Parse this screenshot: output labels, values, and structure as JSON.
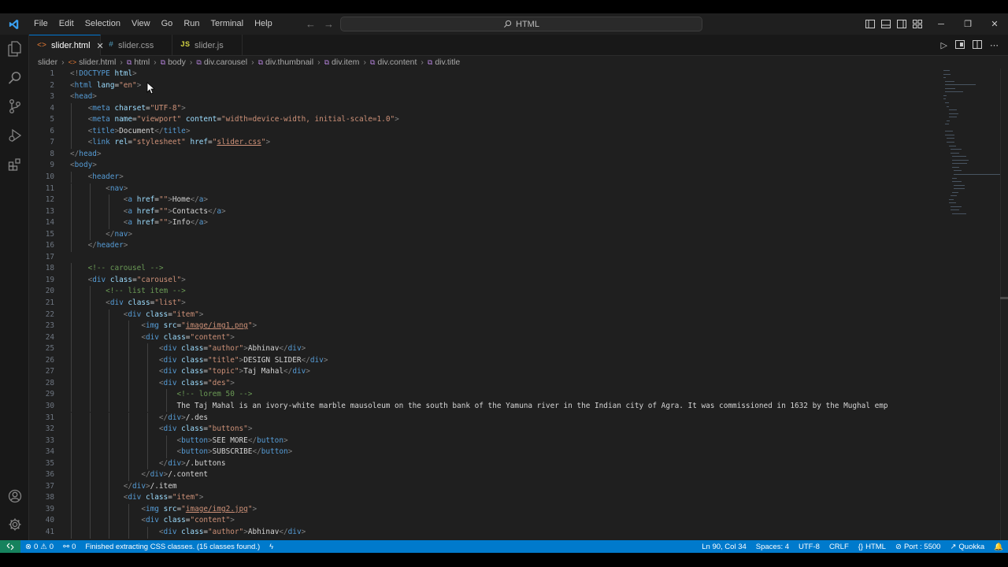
{
  "window": {
    "menu": [
      "File",
      "Edit",
      "Selection",
      "View",
      "Go",
      "Run",
      "Terminal",
      "Help"
    ],
    "search_text": "HTML"
  },
  "tabs": [
    {
      "label": "slider.html",
      "icon": "<>",
      "active": true
    },
    {
      "label": "slider.css",
      "icon": "#",
      "active": false
    },
    {
      "label": "slider.js",
      "icon": "JS",
      "active": false
    }
  ],
  "breadcrumb": [
    "slider",
    "slider.html",
    "html",
    "body",
    "div.carousel",
    "div.thumbnail",
    "div.item",
    "div.content",
    "div.title"
  ],
  "line_numbers": [
    "1",
    "2",
    "3",
    "4",
    "5",
    "6",
    "7",
    "8",
    "9",
    "10",
    "11",
    "12",
    "13",
    "14",
    "15",
    "16",
    "17",
    "18",
    "19",
    "20",
    "21",
    "22",
    "23",
    "24",
    "25",
    "26",
    "27",
    "28",
    "29",
    "30",
    "31",
    "32",
    "33",
    "34",
    "35",
    "36",
    "37",
    "38",
    "39",
    "40",
    "41"
  ],
  "code_lines": [
    [
      [
        "br",
        "<!"
      ],
      [
        "tag",
        "DOCTYPE"
      ],
      [
        "txt",
        " "
      ],
      [
        "attr",
        "html"
      ],
      [
        "br",
        ">"
      ]
    ],
    [
      [
        "br",
        "<"
      ],
      [
        "tag",
        "html"
      ],
      [
        "txt",
        " "
      ],
      [
        "attr",
        "lang"
      ],
      [
        "txt",
        "="
      ],
      [
        "str",
        "\"en\""
      ],
      [
        "br",
        ">"
      ]
    ],
    [
      [
        "br",
        "<"
      ],
      [
        "tag",
        "head"
      ],
      [
        "br",
        ">"
      ]
    ],
    [
      [
        "txt",
        "    "
      ],
      [
        "br",
        "<"
      ],
      [
        "tag",
        "meta"
      ],
      [
        "txt",
        " "
      ],
      [
        "attr",
        "charset"
      ],
      [
        "txt",
        "="
      ],
      [
        "str",
        "\"UTF-8\""
      ],
      [
        "br",
        ">"
      ]
    ],
    [
      [
        "txt",
        "    "
      ],
      [
        "br",
        "<"
      ],
      [
        "tag",
        "meta"
      ],
      [
        "txt",
        " "
      ],
      [
        "attr",
        "name"
      ],
      [
        "txt",
        "="
      ],
      [
        "str",
        "\"viewport\""
      ],
      [
        "txt",
        " "
      ],
      [
        "attr",
        "content"
      ],
      [
        "txt",
        "="
      ],
      [
        "str",
        "\"width=device-width, initial-scale=1.0\""
      ],
      [
        "br",
        ">"
      ]
    ],
    [
      [
        "txt",
        "    "
      ],
      [
        "br",
        "<"
      ],
      [
        "tag",
        "title"
      ],
      [
        "br",
        ">"
      ],
      [
        "txt",
        "Document"
      ],
      [
        "br",
        "</"
      ],
      [
        "tag",
        "title"
      ],
      [
        "br",
        ">"
      ]
    ],
    [
      [
        "txt",
        "    "
      ],
      [
        "br",
        "<"
      ],
      [
        "tag",
        "link"
      ],
      [
        "txt",
        " "
      ],
      [
        "attr",
        "rel"
      ],
      [
        "txt",
        "="
      ],
      [
        "str",
        "\"stylesheet\""
      ],
      [
        "txt",
        " "
      ],
      [
        "attr",
        "href"
      ],
      [
        "txt",
        "="
      ],
      [
        "str",
        "\""
      ],
      [
        "link",
        "slider.css"
      ],
      [
        "str",
        "\""
      ],
      [
        "br",
        ">"
      ]
    ],
    [
      [
        "br",
        "</"
      ],
      [
        "tag",
        "head"
      ],
      [
        "br",
        ">"
      ]
    ],
    [
      [
        "br",
        "<"
      ],
      [
        "tag",
        "body"
      ],
      [
        "br",
        ">"
      ]
    ],
    [
      [
        "txt",
        "    "
      ],
      [
        "br",
        "<"
      ],
      [
        "tag",
        "header"
      ],
      [
        "br",
        ">"
      ]
    ],
    [
      [
        "txt",
        "        "
      ],
      [
        "br",
        "<"
      ],
      [
        "tag",
        "nav"
      ],
      [
        "br",
        ">"
      ]
    ],
    [
      [
        "txt",
        "            "
      ],
      [
        "br",
        "<"
      ],
      [
        "tag",
        "a"
      ],
      [
        "txt",
        " "
      ],
      [
        "attr",
        "href"
      ],
      [
        "txt",
        "="
      ],
      [
        "str",
        "\"\""
      ],
      [
        "br",
        ">"
      ],
      [
        "txt",
        "Home"
      ],
      [
        "br",
        "</"
      ],
      [
        "tag",
        "a"
      ],
      [
        "br",
        ">"
      ]
    ],
    [
      [
        "txt",
        "            "
      ],
      [
        "br",
        "<"
      ],
      [
        "tag",
        "a"
      ],
      [
        "txt",
        " "
      ],
      [
        "attr",
        "href"
      ],
      [
        "txt",
        "="
      ],
      [
        "str",
        "\"\""
      ],
      [
        "br",
        ">"
      ],
      [
        "txt",
        "Contacts"
      ],
      [
        "br",
        "</"
      ],
      [
        "tag",
        "a"
      ],
      [
        "br",
        ">"
      ]
    ],
    [
      [
        "txt",
        "            "
      ],
      [
        "br",
        "<"
      ],
      [
        "tag",
        "a"
      ],
      [
        "txt",
        " "
      ],
      [
        "attr",
        "href"
      ],
      [
        "txt",
        "="
      ],
      [
        "str",
        "\"\""
      ],
      [
        "br",
        ">"
      ],
      [
        "txt",
        "Info"
      ],
      [
        "br",
        "</"
      ],
      [
        "tag",
        "a"
      ],
      [
        "br",
        ">"
      ]
    ],
    [
      [
        "txt",
        "        "
      ],
      [
        "br",
        "</"
      ],
      [
        "tag",
        "nav"
      ],
      [
        "br",
        ">"
      ]
    ],
    [
      [
        "txt",
        "    "
      ],
      [
        "br",
        "</"
      ],
      [
        "tag",
        "header"
      ],
      [
        "br",
        ">"
      ]
    ],
    [],
    [
      [
        "txt",
        "    "
      ],
      [
        "cm",
        "<!-- carousel -->"
      ]
    ],
    [
      [
        "txt",
        "    "
      ],
      [
        "br",
        "<"
      ],
      [
        "tag",
        "div"
      ],
      [
        "txt",
        " "
      ],
      [
        "attr",
        "class"
      ],
      [
        "txt",
        "="
      ],
      [
        "str",
        "\"carousel\""
      ],
      [
        "br",
        ">"
      ]
    ],
    [
      [
        "txt",
        "        "
      ],
      [
        "cm",
        "<!-- list item -->"
      ]
    ],
    [
      [
        "txt",
        "        "
      ],
      [
        "br",
        "<"
      ],
      [
        "tag",
        "div"
      ],
      [
        "txt",
        " "
      ],
      [
        "attr",
        "class"
      ],
      [
        "txt",
        "="
      ],
      [
        "str",
        "\"list\""
      ],
      [
        "br",
        ">"
      ]
    ],
    [
      [
        "txt",
        "            "
      ],
      [
        "br",
        "<"
      ],
      [
        "tag",
        "div"
      ],
      [
        "txt",
        " "
      ],
      [
        "attr",
        "class"
      ],
      [
        "txt",
        "="
      ],
      [
        "str",
        "\"item\""
      ],
      [
        "br",
        ">"
      ]
    ],
    [
      [
        "txt",
        "                "
      ],
      [
        "br",
        "<"
      ],
      [
        "tag",
        "img"
      ],
      [
        "txt",
        " "
      ],
      [
        "attr",
        "src"
      ],
      [
        "txt",
        "="
      ],
      [
        "str",
        "\""
      ],
      [
        "link",
        "image/img1.png"
      ],
      [
        "str",
        "\""
      ],
      [
        "br",
        ">"
      ]
    ],
    [
      [
        "txt",
        "                "
      ],
      [
        "br",
        "<"
      ],
      [
        "tag",
        "div"
      ],
      [
        "txt",
        " "
      ],
      [
        "attr",
        "class"
      ],
      [
        "txt",
        "="
      ],
      [
        "str",
        "\"content\""
      ],
      [
        "br",
        ">"
      ]
    ],
    [
      [
        "txt",
        "                    "
      ],
      [
        "br",
        "<"
      ],
      [
        "tag",
        "div"
      ],
      [
        "txt",
        " "
      ],
      [
        "attr",
        "class"
      ],
      [
        "txt",
        "="
      ],
      [
        "str",
        "\"author\""
      ],
      [
        "br",
        ">"
      ],
      [
        "txt",
        "Abhinav"
      ],
      [
        "br",
        "</"
      ],
      [
        "tag",
        "div"
      ],
      [
        "br",
        ">"
      ]
    ],
    [
      [
        "txt",
        "                    "
      ],
      [
        "br",
        "<"
      ],
      [
        "tag",
        "div"
      ],
      [
        "txt",
        " "
      ],
      [
        "attr",
        "class"
      ],
      [
        "txt",
        "="
      ],
      [
        "str",
        "\"title\""
      ],
      [
        "br",
        ">"
      ],
      [
        "txt",
        "DESIGN SLIDER"
      ],
      [
        "br",
        "</"
      ],
      [
        "tag",
        "div"
      ],
      [
        "br",
        ">"
      ]
    ],
    [
      [
        "txt",
        "                    "
      ],
      [
        "br",
        "<"
      ],
      [
        "tag",
        "div"
      ],
      [
        "txt",
        " "
      ],
      [
        "attr",
        "class"
      ],
      [
        "txt",
        "="
      ],
      [
        "str",
        "\"topic\""
      ],
      [
        "br",
        ">"
      ],
      [
        "txt",
        "Taj Mahal"
      ],
      [
        "br",
        "</"
      ],
      [
        "tag",
        "div"
      ],
      [
        "br",
        ">"
      ]
    ],
    [
      [
        "txt",
        "                    "
      ],
      [
        "br",
        "<"
      ],
      [
        "tag",
        "div"
      ],
      [
        "txt",
        " "
      ],
      [
        "attr",
        "class"
      ],
      [
        "txt",
        "="
      ],
      [
        "str",
        "\"des\""
      ],
      [
        "br",
        ">"
      ]
    ],
    [
      [
        "txt",
        "                        "
      ],
      [
        "cm",
        "<!-- lorem 50 -->"
      ]
    ],
    [
      [
        "txt",
        "                        The Taj Mahal is an ivory-white marble mausoleum on the south bank of the Yamuna river in the Indian city of Agra. It was commissioned in 1632 by the Mughal emp"
      ]
    ],
    [
      [
        "txt",
        "                    "
      ],
      [
        "br",
        "</"
      ],
      [
        "tag",
        "div"
      ],
      [
        "br",
        ">"
      ],
      [
        "txt",
        "/.des"
      ]
    ],
    [
      [
        "txt",
        "                    "
      ],
      [
        "br",
        "<"
      ],
      [
        "tag",
        "div"
      ],
      [
        "txt",
        " "
      ],
      [
        "attr",
        "class"
      ],
      [
        "txt",
        "="
      ],
      [
        "str",
        "\"buttons\""
      ],
      [
        "br",
        ">"
      ]
    ],
    [
      [
        "txt",
        "                        "
      ],
      [
        "br",
        "<"
      ],
      [
        "tag",
        "button"
      ],
      [
        "br",
        ">"
      ],
      [
        "txt",
        "SEE MORE"
      ],
      [
        "br",
        "</"
      ],
      [
        "tag",
        "button"
      ],
      [
        "br",
        ">"
      ]
    ],
    [
      [
        "txt",
        "                        "
      ],
      [
        "br",
        "<"
      ],
      [
        "tag",
        "button"
      ],
      [
        "br",
        ">"
      ],
      [
        "txt",
        "SUBSCRIBE"
      ],
      [
        "br",
        "</"
      ],
      [
        "tag",
        "button"
      ],
      [
        "br",
        ">"
      ]
    ],
    [
      [
        "txt",
        "                    "
      ],
      [
        "br",
        "</"
      ],
      [
        "tag",
        "div"
      ],
      [
        "br",
        ">"
      ],
      [
        "txt",
        "/.buttons"
      ]
    ],
    [
      [
        "txt",
        "                "
      ],
      [
        "br",
        "</"
      ],
      [
        "tag",
        "div"
      ],
      [
        "br",
        ">"
      ],
      [
        "txt",
        "/.content"
      ]
    ],
    [
      [
        "txt",
        "            "
      ],
      [
        "br",
        "</"
      ],
      [
        "tag",
        "div"
      ],
      [
        "br",
        ">"
      ],
      [
        "txt",
        "/.item"
      ]
    ],
    [
      [
        "txt",
        "            "
      ],
      [
        "br",
        "<"
      ],
      [
        "tag",
        "div"
      ],
      [
        "txt",
        " "
      ],
      [
        "attr",
        "class"
      ],
      [
        "txt",
        "="
      ],
      [
        "str",
        "\"item\""
      ],
      [
        "br",
        ">"
      ]
    ],
    [
      [
        "txt",
        "                "
      ],
      [
        "br",
        "<"
      ],
      [
        "tag",
        "img"
      ],
      [
        "txt",
        " "
      ],
      [
        "attr",
        "src"
      ],
      [
        "txt",
        "="
      ],
      [
        "str",
        "\""
      ],
      [
        "link",
        "image/img2.jpg"
      ],
      [
        "str",
        "\""
      ],
      [
        "br",
        ">"
      ]
    ],
    [
      [
        "txt",
        "                "
      ],
      [
        "br",
        "<"
      ],
      [
        "tag",
        "div"
      ],
      [
        "txt",
        " "
      ],
      [
        "attr",
        "class"
      ],
      [
        "txt",
        "="
      ],
      [
        "str",
        "\"content\""
      ],
      [
        "br",
        ">"
      ]
    ],
    [
      [
        "txt",
        "                    "
      ],
      [
        "br",
        "<"
      ],
      [
        "tag",
        "div"
      ],
      [
        "txt",
        " "
      ],
      [
        "attr",
        "class"
      ],
      [
        "txt",
        "="
      ],
      [
        "str",
        "\"author\""
      ],
      [
        "br",
        ">"
      ],
      [
        "txt",
        "Abhinav"
      ],
      [
        "br",
        "</"
      ],
      [
        "tag",
        "div"
      ],
      [
        "br",
        ">"
      ]
    ]
  ],
  "status": {
    "errors": "0",
    "warnings": "0",
    "ports": "0",
    "message": "Finished extracting CSS classes. (15 classes found.)",
    "position": "Ln 90, Col 34",
    "spaces": "Spaces: 4",
    "encoding": "UTF-8",
    "eol": "CRLF",
    "language": "HTML",
    "port": "Port : 5500",
    "quokka": "Quokka"
  },
  "colors": {
    "accent": "#007acc",
    "editor_bg": "#1f1f1f",
    "tag": "#569cd6",
    "attr": "#9cdcfe",
    "string": "#ce9178",
    "comment": "#6a9955"
  }
}
